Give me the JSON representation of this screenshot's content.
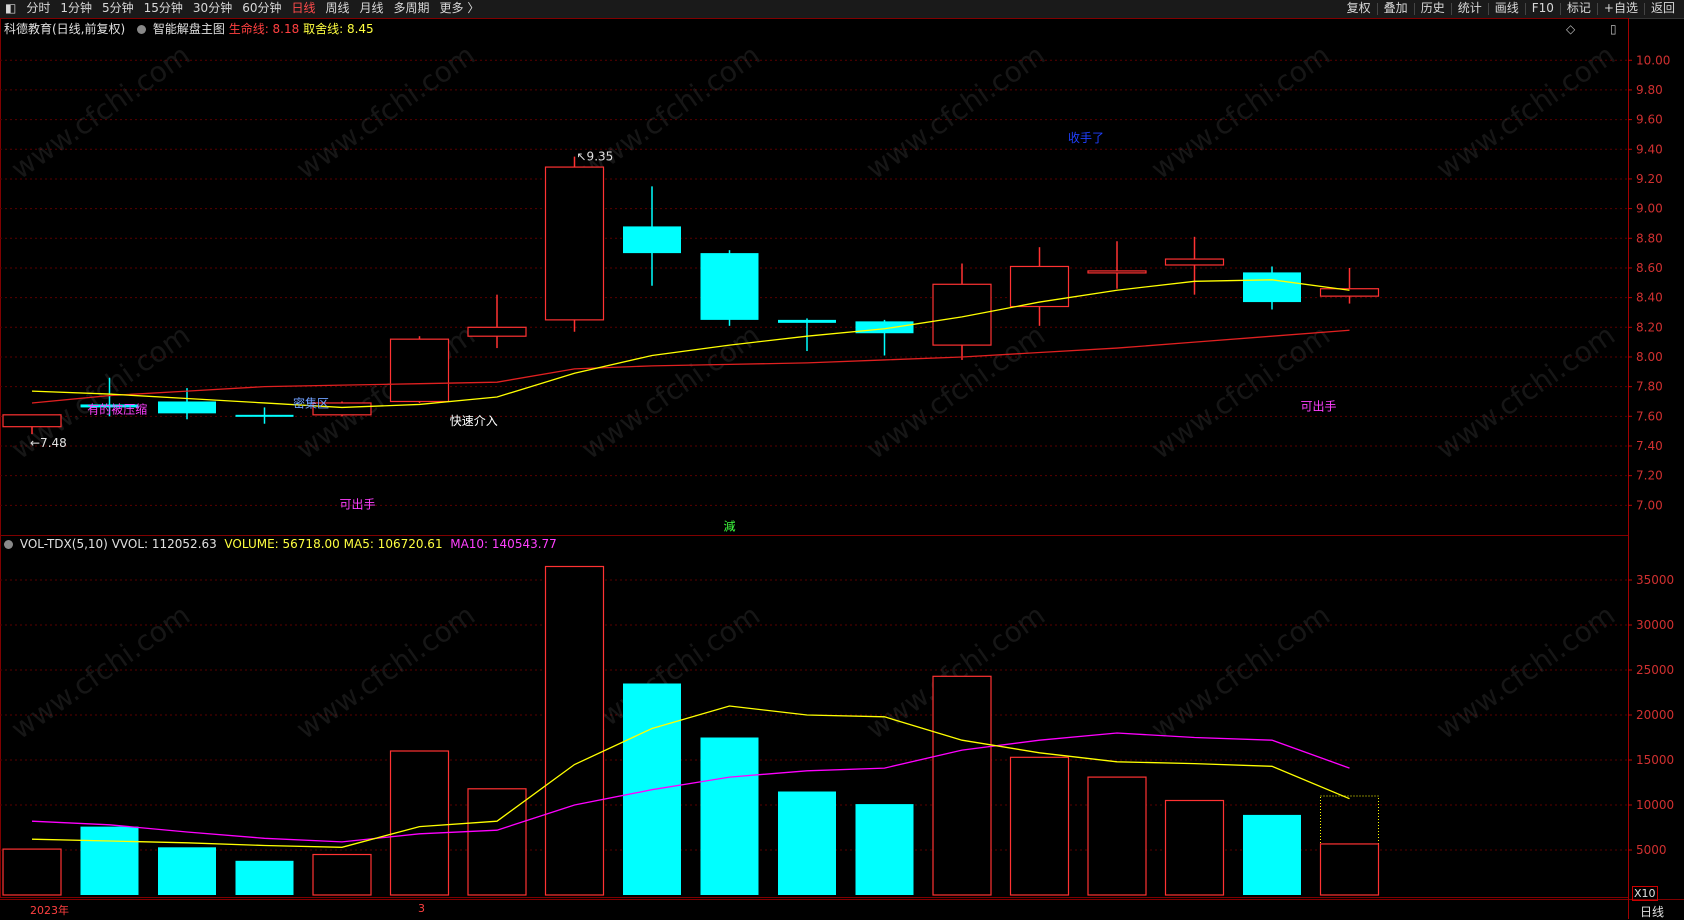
{
  "toolbar": {
    "left_items": [
      "分时",
      "1分钟",
      "5分钟",
      "15分钟",
      "30分钟",
      "60分钟",
      "日线",
      "周线",
      "月线",
      "多周期",
      "更多 〉"
    ],
    "active": "日线",
    "right_items": [
      "复权",
      "叠加",
      "历史",
      "统计",
      "画线",
      "F10",
      "标记",
      "+自选",
      "返回"
    ]
  },
  "main_header": {
    "stock": "科德教育(日线,前复权)",
    "indicator": "智能解盘主图",
    "life_line": "生命线: 8.18",
    "exit_line": "取舍线: 8.45"
  },
  "vol_header": {
    "name": "VOL-TDX(5,10)",
    "vvol": "VVOL: 112052.63",
    "volume": "VOLUME: 56718.00",
    "ma5": "MA5: 106720.61",
    "ma10": "MA10: 140543.77"
  },
  "footer": {
    "date_left": "2023年",
    "date_mid": "3",
    "x10": "X10",
    "period": "日线"
  },
  "colors": {
    "up": "#ff3232",
    "down": "#00ffff",
    "ma_yellow": "#ffff00",
    "ma_magenta": "#ff00ff",
    "life_line": "#e02020"
  },
  "chart_data": [
    {
      "type": "candlestick",
      "title": "科德教育(日线,前复权)",
      "ylim": [
        6.8,
        10.15
      ],
      "yticks": [
        "10.00",
        "9.80",
        "9.60",
        "9.40",
        "9.20",
        "9.00",
        "8.80",
        "8.60",
        "8.40",
        "8.20",
        "8.00",
        "7.80",
        "7.60",
        "7.40",
        "7.20",
        "7.00"
      ],
      "candles": [
        {
          "open": 7.53,
          "close": 7.61,
          "high": 7.61,
          "low": 7.48
        },
        {
          "open": 7.68,
          "close": 7.66,
          "high": 7.86,
          "low": 7.6
        },
        {
          "open": 7.7,
          "close": 7.62,
          "high": 7.79,
          "low": 7.58
        },
        {
          "open": 7.61,
          "close": 7.6,
          "high": 7.66,
          "low": 7.55
        },
        {
          "open": 7.61,
          "close": 7.69,
          "high": 7.7,
          "low": 7.6
        },
        {
          "open": 7.7,
          "close": 8.12,
          "high": 8.14,
          "low": 7.69
        },
        {
          "open": 8.14,
          "close": 8.2,
          "high": 8.42,
          "low": 8.06
        },
        {
          "open": 8.25,
          "close": 9.28,
          "high": 9.35,
          "low": 8.17
        },
        {
          "open": 8.88,
          "close": 8.7,
          "high": 9.15,
          "low": 8.48
        },
        {
          "open": 8.7,
          "close": 8.25,
          "high": 8.72,
          "low": 8.21
        },
        {
          "open": 8.25,
          "close": 8.23,
          "high": 8.26,
          "low": 8.04
        },
        {
          "open": 8.24,
          "close": 8.16,
          "high": 8.25,
          "low": 8.01
        },
        {
          "open": 8.08,
          "close": 8.49,
          "high": 8.63,
          "low": 7.98
        },
        {
          "open": 8.34,
          "close": 8.61,
          "high": 8.74,
          "low": 8.21
        },
        {
          "open": 8.58,
          "close": 8.58,
          "high": 8.78,
          "low": 8.46
        },
        {
          "open": 8.62,
          "close": 8.66,
          "high": 8.81,
          "low": 8.42
        },
        {
          "open": 8.57,
          "close": 8.37,
          "high": 8.61,
          "low": 8.32
        },
        {
          "open": 8.41,
          "close": 8.46,
          "high": 8.6,
          "low": 8.36
        }
      ],
      "ma_yellow": [
        7.77,
        7.75,
        7.72,
        7.69,
        7.66,
        7.68,
        7.73,
        7.89,
        8.01,
        8.08,
        8.14,
        8.19,
        8.27,
        8.37,
        8.45,
        8.51,
        8.52,
        8.45
      ],
      "life_line": [
        7.69,
        7.74,
        7.77,
        7.8,
        7.81,
        7.82,
        7.83,
        7.92,
        7.94,
        7.95,
        7.96,
        7.98,
        8.0,
        8.03,
        8.06,
        8.1,
        8.14,
        8.18
      ],
      "price_labels": [
        {
          "index": 0,
          "text": "←7.48",
          "price": 7.48
        },
        {
          "index": 7,
          "text": "↖9.35",
          "price": 9.35
        }
      ],
      "annotations": [
        {
          "text": "有的被压缩",
          "index": 1.1,
          "price": 7.62,
          "color": "#ff40ff"
        },
        {
          "text": "密集区",
          "index": 3.6,
          "price": 7.66,
          "color": "#6fa0ff"
        },
        {
          "text": "快速介入",
          "index": 5.7,
          "price": 7.54,
          "color": "#ffffff"
        },
        {
          "text": "收手了",
          "index": 13.6,
          "price": 9.45,
          "color": "#2040ff"
        },
        {
          "text": "可出手",
          "index": 16.6,
          "price": 7.64,
          "color": "#ff40ff"
        },
        {
          "text": "可出手",
          "index": 4.2,
          "price": 6.98,
          "color": "#ff40ff"
        },
        {
          "text": "減",
          "index": 9.0,
          "price": 6.83,
          "color": "#40ff40"
        }
      ]
    },
    {
      "type": "bar",
      "title": "VOL-TDX(5,10)",
      "ylim": [
        0,
        38000
      ],
      "yticks": [
        35000,
        30000,
        25000,
        20000,
        15000,
        10000,
        5000
      ],
      "volume": [
        5100,
        7600,
        5300,
        3800,
        4500,
        16000,
        11800,
        36500,
        23500,
        17500,
        11500,
        10100,
        24300,
        15300,
        13100,
        10500,
        8900,
        11000
      ],
      "volume_inner": [
        null,
        null,
        null,
        null,
        null,
        null,
        null,
        null,
        null,
        null,
        null,
        null,
        null,
        null,
        null,
        null,
        null,
        5672
      ],
      "ma5": [
        6200,
        6000,
        5800,
        5500,
        5300,
        7600,
        8200,
        14500,
        18500,
        21000,
        20000,
        19800,
        17200,
        15800,
        14800,
        14600,
        14300,
        10700
      ],
      "ma10": [
        8200,
        7800,
        7000,
        6300,
        5900,
        6800,
        7200,
        10000,
        11700,
        13100,
        13800,
        14100,
        16100,
        17200,
        18000,
        17500,
        17200,
        14100
      ]
    }
  ]
}
